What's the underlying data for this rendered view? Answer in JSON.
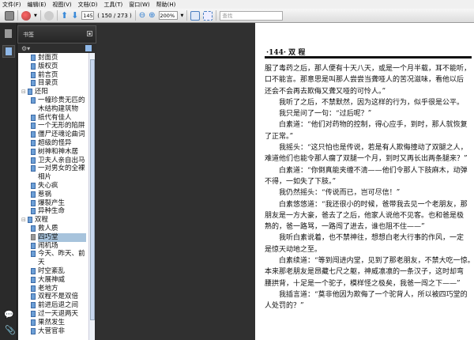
{
  "menu": [
    "文件(F)",
    "编辑(E)",
    "视图(V)",
    "文档(D)",
    "工具(T)",
    "窗口(W)",
    "帮助(H)"
  ],
  "toolbar": {
    "page_input": "145",
    "page_count": "( 150 / 273 )",
    "zoom": "200%",
    "search_placeholder": "查找"
  },
  "panel": {
    "title": "书签"
  },
  "tree": [
    {
      "label": "封面页",
      "level": 1
    },
    {
      "label": "版权页",
      "level": 1
    },
    {
      "label": "前言页",
      "level": 1
    },
    {
      "label": "目录页",
      "level": 1
    },
    {
      "label": "还阳",
      "level": 0,
      "expander": "⊟"
    },
    {
      "label": "一幢珍贵无匹的木结构建筑物",
      "level": 1
    },
    {
      "label": "纸代有佳人",
      "level": 1
    },
    {
      "label": "一个无形的陷阱",
      "level": 1
    },
    {
      "label": "僵尸还魂论曲词",
      "level": 1
    },
    {
      "label": "超级的怪异",
      "level": 1
    },
    {
      "label": "树神和神木居",
      "level": 1
    },
    {
      "label": "卫夫人亲自出马",
      "level": 1
    },
    {
      "label": "一对男女的全裸相片",
      "level": 1
    },
    {
      "label": "失心疯",
      "level": 1
    },
    {
      "label": "惹祸",
      "level": 1
    },
    {
      "label": "爆裂产生",
      "level": 1
    },
    {
      "label": "异种生命",
      "level": 1
    },
    {
      "label": "双程",
      "level": 0,
      "expander": "⊟"
    },
    {
      "label": "救人质",
      "level": 1
    },
    {
      "label": "四巧堂",
      "level": 1,
      "selected": true
    },
    {
      "label": "闹机场",
      "level": 1
    },
    {
      "label": "今天、昨天、前天",
      "level": 1
    },
    {
      "label": "时空紊乱",
      "level": 1
    },
    {
      "label": "大展神威",
      "level": 1
    },
    {
      "label": "老地方",
      "level": 1
    },
    {
      "label": "双程不是双倍",
      "level": 1
    },
    {
      "label": "前进后退之间",
      "level": 1
    },
    {
      "label": "过一天退两天",
      "level": 1
    },
    {
      "label": "果然发生",
      "level": 1
    },
    {
      "label": "大营官非",
      "level": 1
    }
  ],
  "document": {
    "header": "·144·   双  程",
    "lines": [
      {
        "t": "服了毒药之后，那人便有十天八天，或是一个月半载，耳不能听，"
      },
      {
        "t": "口不能言。那意思是叫那人尝尝当聋哑人的苦况滋味，看他以后"
      },
      {
        "t": "还会不会再去欺侮又聋又哑的可怜人。”"
      },
      {
        "t": "我听了之后，不禁默然，因为这样的行为，似乎很是公平。",
        "i": 1
      },
      {
        "t": "我只是问了一句：“过后呢？”",
        "i": 1
      },
      {
        "t": "白素道：“他们对药物的控制，得心应手，到时，那人就恢复",
        "i": 1
      },
      {
        "t": "了正常。”"
      },
      {
        "t": "我摇头：“这只怕也是传说，若是有人欺侮撞动了双腿之人，",
        "i": 1
      },
      {
        "t": "难道他们也能令那人瘸了双腿一个月，到时又再长出两条腿来？”"
      },
      {
        "t": "白素道：“你倒真能夹缠不清——他们令那人下肢麻木，动弹",
        "i": 1
      },
      {
        "t": "不得，一如失了下肢。”"
      },
      {
        "t": "我仍然摇头：“传说而已，岂可尽信！”",
        "i": 1
      },
      {
        "t": "白素悠悠道：“我还很小的时候，爸带我去见一个老朋友，那",
        "i": 1
      },
      {
        "t": "朋友是一方大豪，爸去了之后，他家人说他不见客。也和爸是极"
      },
      {
        "t": "熟的，爸一路骂，一路闯了进去，谁也阻不住——”"
      },
      {
        "t": "我听白素说着，也不禁神往，想想白老大行事的作风，一定",
        "i": 1
      },
      {
        "t": "是惊天动地之至。"
      },
      {
        "t": "白素续道：“等到闯进内堂，见到了那老朋友，不禁大吃一惊。",
        "i": 1
      },
      {
        "t": "本来那老朋友是昂藏七尺之躯，神威凛凛的一条汉子，这时却弯"
      },
      {
        "t": "腰拱背，十足是一个驼子，模样怪之极矣，我爸一闯之下——”"
      },
      {
        "t": "我插言道：“莫非他因为欺侮了一个驼背人，所以被四巧堂的",
        "i": 1
      },
      {
        "t": "人处罚的？”"
      }
    ]
  }
}
